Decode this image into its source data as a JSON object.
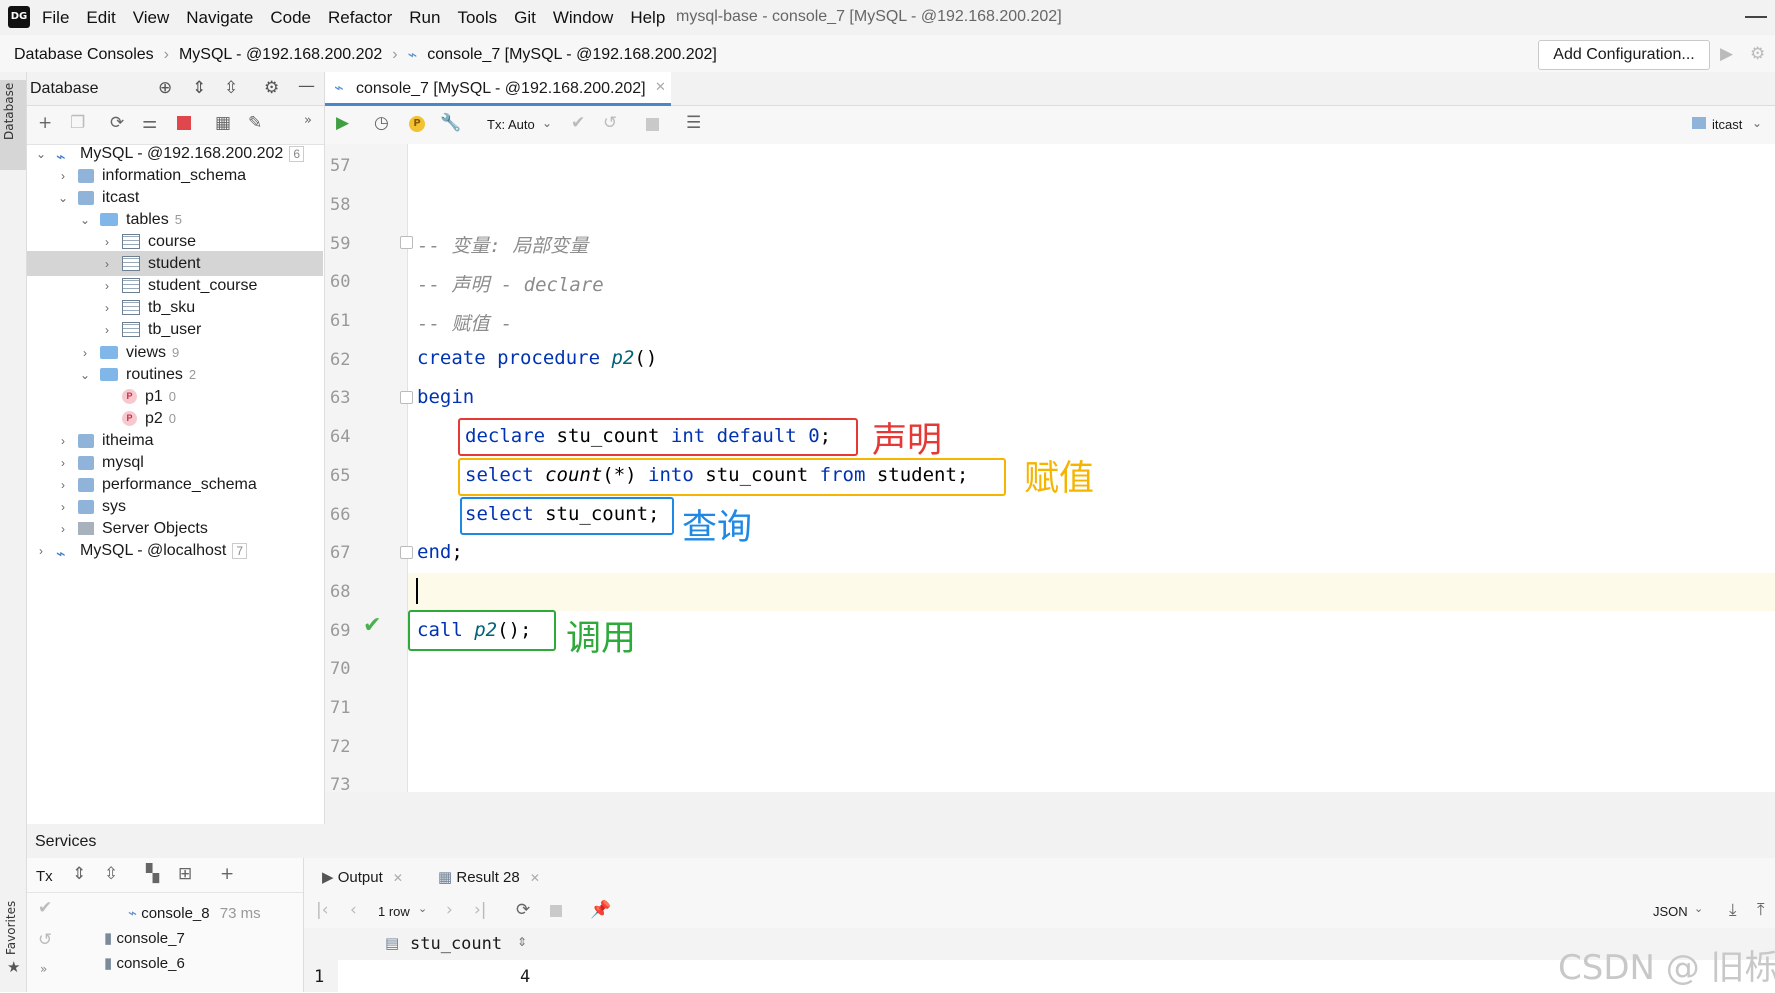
{
  "menu": {
    "items": [
      "File",
      "Edit",
      "View",
      "Navigate",
      "Code",
      "Refactor",
      "Run",
      "Tools",
      "Git",
      "Window",
      "Help"
    ],
    "window_title": "mysql-base - console_7 [MySQL - @192.168.200.202]"
  },
  "nav": {
    "breadcrumb": [
      "Database Consoles",
      "MySQL - @192.168.200.202",
      "console_7 [MySQL - @192.168.200.202]"
    ],
    "add_config": "Add Configuration..."
  },
  "side_strip": {
    "database": "Database",
    "favorites": "Favorites"
  },
  "db_panel": {
    "title": "Database",
    "tree": [
      {
        "label": "MySQL - @192.168.200.202",
        "count": "6"
      },
      {
        "label": "information_schema"
      },
      {
        "label": "itcast"
      },
      {
        "label": "tables",
        "count": "5"
      },
      {
        "label": "course"
      },
      {
        "label": "student"
      },
      {
        "label": "student_course"
      },
      {
        "label": "tb_sku"
      },
      {
        "label": "tb_user"
      },
      {
        "label": "views",
        "count": "9"
      },
      {
        "label": "routines",
        "count": "2"
      },
      {
        "label": "p1",
        "count": "0"
      },
      {
        "label": "p2",
        "count": "0"
      },
      {
        "label": "itheima"
      },
      {
        "label": "mysql"
      },
      {
        "label": "performance_schema"
      },
      {
        "label": "sys"
      },
      {
        "label": "Server Objects"
      },
      {
        "label": "MySQL - @localhost",
        "count": "7"
      }
    ]
  },
  "editor": {
    "tab_label": "console_7 [MySQL - @192.168.200.202]",
    "tx_mode": "Tx: Auto",
    "schema": "itcast",
    "line_numbers": [
      "57",
      "58",
      "59",
      "60",
      "61",
      "62",
      "63",
      "64",
      "65",
      "66",
      "67",
      "68",
      "69",
      "70",
      "71",
      "72",
      "73"
    ],
    "code": {
      "l59": "-- 变量: 局部变量",
      "l60": "-- 声明 - declare",
      "l61": "-- 赋值 -",
      "l62_kw": "create procedure",
      "l62_fn": "p2",
      "l62_tail": "()",
      "l63": "begin",
      "l64_kw": "declare",
      "l64_mid": " stu_count ",
      "l64_kw2": "int default",
      "l64_num": " 0",
      "l64_tail": ";",
      "l65_kw": "select",
      "l65_fn": " count",
      "l65_mid": "(*) ",
      "l65_kw2": "into",
      "l65_mid2": " stu_count ",
      "l65_kw3": "from",
      "l65_tail": " student;",
      "l66_kw": "select",
      "l66_tail": " stu_count;",
      "l67_kw": "end",
      "l67_tail": ";",
      "l69_kw": "call",
      "l69_fn": " p2",
      "l69_tail": "();"
    },
    "annotations": {
      "declare": "声明",
      "assign": "赋值",
      "query": "查询",
      "call": "调用"
    },
    "colors": {
      "declare": "#e53935",
      "assign": "#f5b400",
      "query": "#1e88e5",
      "call": "#2eaa3a"
    }
  },
  "services": {
    "title": "Services",
    "tx": "Tx",
    "items": [
      {
        "label": "console_8",
        "time": "73 ms"
      },
      {
        "label": "console_7"
      },
      {
        "label": "console_6"
      }
    ],
    "tabs": [
      "Output",
      "Result 28"
    ],
    "rows_label": "1 row",
    "format": "JSON",
    "column": "stu_count",
    "row_num": "1",
    "value": "4"
  },
  "watermark": "CSDN @ 旧栎"
}
